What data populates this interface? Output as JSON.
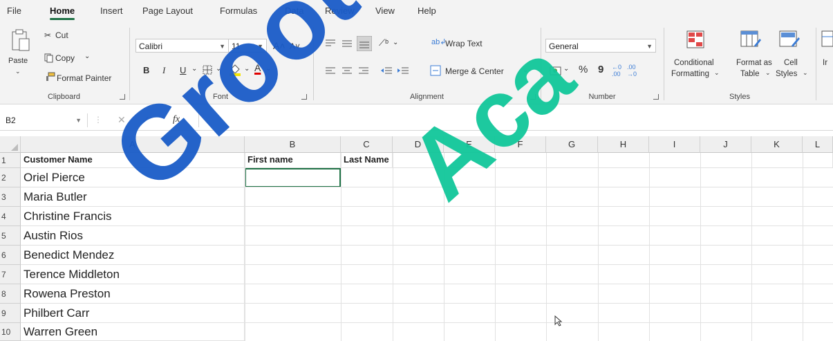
{
  "menu": {
    "tabs": [
      "File",
      "Home",
      "Insert",
      "Page Layout",
      "Formulas",
      "Data",
      "Review",
      "View",
      "Help"
    ],
    "active": "Home"
  },
  "ribbon": {
    "clipboard": {
      "label": "Clipboard",
      "paste": "Paste",
      "cut": "Cut",
      "copy": "Copy",
      "format_painter": "Format Painter"
    },
    "font": {
      "label": "Font",
      "family": "Calibri",
      "size": "11",
      "bold": "B",
      "italic": "I",
      "underline": "U"
    },
    "alignment": {
      "label": "Alignment",
      "wrap_text": "Wrap Text",
      "merge_center": "Merge & Center"
    },
    "number": {
      "label": "Number",
      "format": "General",
      "percent": "%",
      "comma": "9"
    },
    "styles": {
      "label": "Styles",
      "conditional_1": "Conditional",
      "conditional_2": "Formatting",
      "format_as_1": "Format as",
      "format_as_2": "Table",
      "cell_styles_1": "Cell",
      "cell_styles_2": "Styles"
    },
    "cells_partial": "Ir"
  },
  "formula_bar": {
    "name_box": "B2",
    "fx": "fx",
    "value": ""
  },
  "columns": [
    "A",
    "B",
    "C",
    "D",
    "E",
    "F",
    "G",
    "H",
    "I",
    "J",
    "K",
    "L"
  ],
  "rows": [
    {
      "num": "1",
      "a": "Customer Name",
      "b": "First name",
      "c": "Last Name"
    },
    {
      "num": "2",
      "a": "Oriel Pierce"
    },
    {
      "num": "3",
      "a": "Maria Butler"
    },
    {
      "num": "4",
      "a": "Christine Francis"
    },
    {
      "num": "5",
      "a": "Austin Rios"
    },
    {
      "num": "6",
      "a": "Benedict Mendez"
    },
    {
      "num": "7",
      "a": "Terence Middleton"
    },
    {
      "num": "8",
      "a": "Rowena Preston"
    },
    {
      "num": "9",
      "a": "Philbert Carr"
    },
    {
      "num": "10",
      "a": "Warren Green"
    }
  ],
  "watermark": {
    "word1": "Groot",
    "word2": "Aca",
    "color1": "#1a5cc8",
    "color2": "#11c79a"
  },
  "colors": {
    "accent": "#1e7145",
    "header_bg": "#efefef",
    "ribbon_bg": "#f3f3f3"
  }
}
